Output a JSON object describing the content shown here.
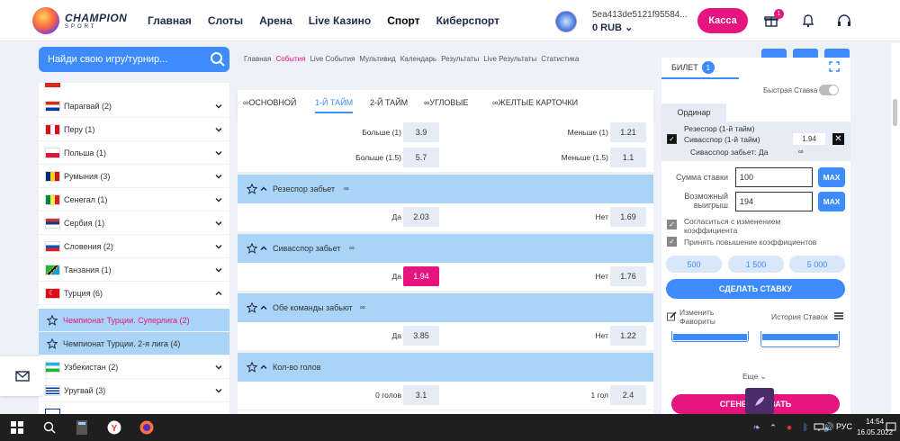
{
  "header": {
    "logo_line1": "CHAMPION",
    "logo_line2": "SPORT",
    "nav": [
      "Главная",
      "Слоты",
      "Арена",
      "Live Казино",
      "Спорт",
      "Киберспорт"
    ],
    "user_id": "5ea413de5121f95584...",
    "balance": "0 RUB",
    "kassa": "Касса",
    "gift_badge": "1"
  },
  "search": {
    "placeholder": "Найди свою игру/турнир..."
  },
  "sidebar": {
    "countries": [
      {
        "label": "Парагвай (2)",
        "flag": "paraguay-flag"
      },
      {
        "label": "Перу (1)",
        "flag": "peru-flag"
      },
      {
        "label": "Польша (1)",
        "flag": "poland-flag"
      },
      {
        "label": "Румыния (3)",
        "flag": "romania-flag"
      },
      {
        "label": "Сенегал (1)",
        "flag": "senegal-flag"
      },
      {
        "label": "Сербия (1)",
        "flag": "serbia-flag"
      },
      {
        "label": "Словения (2)",
        "flag": "slovenia-flag"
      },
      {
        "label": "Танзания (1)",
        "flag": "tanzania-flag"
      },
      {
        "label": "Турция (6)",
        "flag": "turkey-flag"
      }
    ],
    "leagues": [
      "Чемпионат Турции. Суперлига (2)",
      "Чемпионат Турции. 2-я лига (4)"
    ],
    "countries_after": [
      {
        "label": "Узбекистан (2)",
        "flag": "uzbekistan-flag"
      },
      {
        "label": "Уругвай (3)",
        "flag": "uruguay-flag"
      }
    ]
  },
  "breadcrumbs": [
    "Главная",
    "События",
    "Live События",
    "Мультивид",
    "Календарь",
    "Результаты",
    "Live Результаты",
    "Статистика"
  ],
  "market_tabs": [
    "ОСНОВНОЙ",
    "1-Й ТАЙМ",
    "2-Й ТАЙМ",
    "УГЛОВЫЕ",
    "ЖЕЛТЫЕ КАРТОЧКИ"
  ],
  "markets": {
    "top_rows": [
      {
        "left_label": "Больше (1)",
        "left_odd": "3.9",
        "right_label": "Меньше (1)",
        "right_odd": "1.21"
      },
      {
        "left_label": "Больше (1.5)",
        "left_odd": "5.7",
        "right_label": "Меньше (1.5)",
        "right_odd": "1.1"
      }
    ],
    "blocks": [
      {
        "title": "Резеспор забьет",
        "left_label": "Да",
        "left_odd": "2.03",
        "right_label": "Нет",
        "right_odd": "1.69"
      },
      {
        "title": "Сивасспор забьет",
        "left_label": "Да",
        "left_odd": "1.94",
        "right_label": "Нет",
        "right_odd": "1.76"
      },
      {
        "title": "Обе команды забьют",
        "left_label": "Да",
        "left_odd": "3.85",
        "right_label": "Нет",
        "right_odd": "1.22"
      },
      {
        "title": "Кол-во голов",
        "left_label": "0 голов",
        "left_odd": "3.1",
        "right_label": "1 гол",
        "right_odd": "2.4"
      }
    ]
  },
  "betslip": {
    "tab": "БИЛЕТ",
    "count": "1",
    "quick_bet": "Быстрая Ставка",
    "ordinar": "Ординар",
    "item_line1": "Резеспор (1-й тайм)",
    "item_line2": "Сивасспор (1-й тайм)",
    "item_line3": "Сивасспор забьет: Да",
    "item_odd": "1.94",
    "stake_label": "Сумма ставки",
    "stake_value": "100",
    "win_label_1": "Возможный",
    "win_label_2": "выигрыш",
    "win_value": "194",
    "max": "MAX",
    "agree1_line1": "Согласиться с изменением",
    "agree1_line2": "коэффициента",
    "agree2": "Принять повышение коэффициентов",
    "amounts": [
      "500",
      "1 500",
      "5 000"
    ],
    "make_bet": "СДЕЛАТЬ СТАВКУ",
    "edit_fav_1": "Изменить",
    "edit_fav_2": "Фавориты",
    "history": "История Ставок",
    "more": "Еще",
    "generate": "СГЕНЕРИРОВАТЬ"
  },
  "taskbar": {
    "lang": "РУС",
    "time": "14:54",
    "date": "16.05.2022"
  },
  "colors": {
    "accent": "#3d8bfd",
    "brand": "#e5147f",
    "selected_row": "#a9d3f7"
  }
}
